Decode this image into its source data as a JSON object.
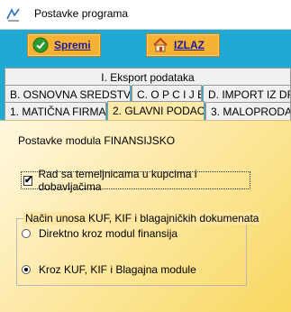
{
  "window": {
    "title": "Postavke programa"
  },
  "toolbar": {
    "save_label": "Spremi",
    "exit_label": "IZLAZ"
  },
  "tabs": {
    "row1": [
      {
        "label": "I. Eksport podataka"
      }
    ],
    "row2": [
      {
        "label": "B. OSNOVNA SREDSTVA"
      },
      {
        "label": "C. O P C I J E"
      },
      {
        "label": "D. IMPORT IZ DRU"
      }
    ],
    "row3": [
      {
        "label": "1. MATIČNA FIRMA"
      },
      {
        "label": "2. GLAVNI PODACI"
      },
      {
        "label": "3. MALOPRODAJ"
      }
    ]
  },
  "panel": {
    "section_title": "Postavke modula FINANSIJSKO",
    "checkbox_label": "Rad sa temeljnicama u kupcima i dobavljačima",
    "checkbox_checked": true,
    "group_title": "Način unosa KUF, KIF i blagajničkih dokumenata",
    "radio_options": [
      {
        "label": "Direktno kroz modul finansija",
        "selected": false
      },
      {
        "label": "Kroz KUF, KIF i Blagajna module",
        "selected": true
      }
    ]
  },
  "colors": {
    "accent": "#20a9d2",
    "button": "#f7b233",
    "panel": "#fde9a6"
  }
}
